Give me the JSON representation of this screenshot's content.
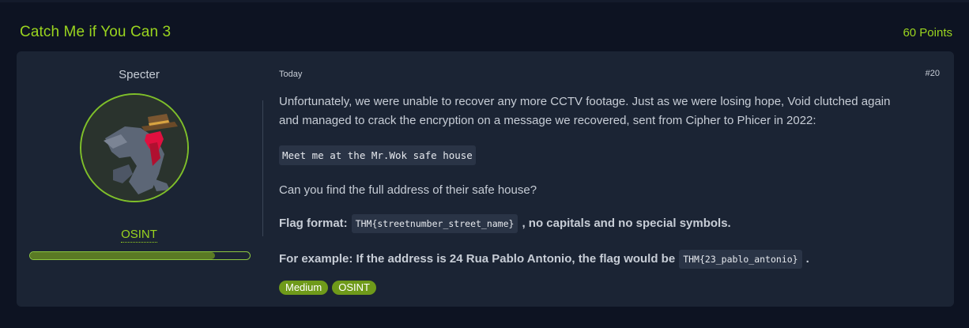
{
  "challenge": {
    "title": "Catch Me if You Can 3",
    "points": "60 Points"
  },
  "author": {
    "name": "Specter",
    "rank": "OSINT",
    "progress_fraction": 0.84
  },
  "post": {
    "date": "Today",
    "number": "#20",
    "paragraph1": "Unfortunately, we were unable to recover any more CCTV footage. Just as we were losing hope, Void clutched again and managed to crack the encryption on a message we recovered, sent from Cipher to Phicer in 2022:",
    "message_code": "Meet me at the Mr.Wok safe house",
    "question": "Can you find the full address of their safe house?",
    "flag_label": "Flag format:",
    "flag_code": "THM{streetnumber_street_name}",
    "flag_suffix": ", no capitals and no special symbols.",
    "example_label": "For example: If the address is 24 Rua Pablo Antonio, the flag would be",
    "example_code": "THM{23_pablo_antonio}",
    "example_suffix": ".",
    "tags": [
      "Medium",
      "OSINT"
    ]
  },
  "colors": {
    "accent_green": "#9ad41f",
    "card_bg": "#1b2434",
    "page_bg": "#0d1322",
    "tag_bg": "#6f9a1a"
  }
}
